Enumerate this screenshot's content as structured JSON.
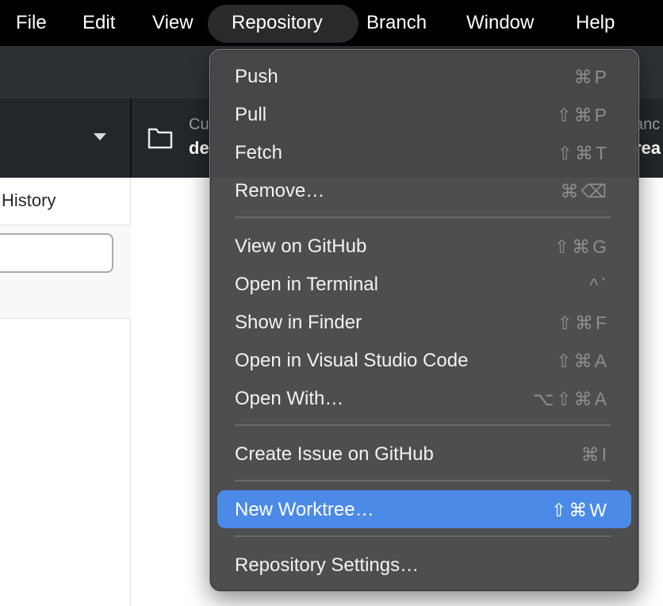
{
  "menubar": {
    "items": [
      {
        "label": "File"
      },
      {
        "label": "Edit"
      },
      {
        "label": "View"
      },
      {
        "label": "Repository"
      },
      {
        "label": "Branch"
      },
      {
        "label": "Window"
      },
      {
        "label": "Help"
      }
    ]
  },
  "toolbar": {
    "repo_label": "Cu",
    "repo_value": "de",
    "branch_label": "anc",
    "branch_value": "rea"
  },
  "left_pane": {
    "history_tab": "History"
  },
  "menu": {
    "items": [
      {
        "label": "Push",
        "shortcut": "⌘P"
      },
      {
        "label": "Pull",
        "shortcut": "⇧⌘P"
      },
      {
        "label": "Fetch",
        "shortcut": "⇧⌘T"
      },
      {
        "label": "Remove…",
        "shortcut": "⌘⌫"
      },
      {
        "label": "View on GitHub",
        "shortcut": "⇧⌘G"
      },
      {
        "label": "Open in Terminal",
        "shortcut": "^`"
      },
      {
        "label": "Show in Finder",
        "shortcut": "⇧⌘F"
      },
      {
        "label": "Open in Visual Studio Code",
        "shortcut": "⇧⌘A"
      },
      {
        "label": "Open With…",
        "shortcut": "⌥⇧⌘A"
      },
      {
        "label": "Create Issue on GitHub",
        "shortcut": "⌘I"
      },
      {
        "label": "New Worktree…",
        "shortcut": "⇧⌘W"
      },
      {
        "label": "Repository Settings…",
        "shortcut": ""
      }
    ],
    "highlighted": "New Worktree…"
  },
  "colors": {
    "highlight": "#4b8ae7",
    "menu_bg": "#48484a",
    "menubar_bg": "#000000"
  }
}
